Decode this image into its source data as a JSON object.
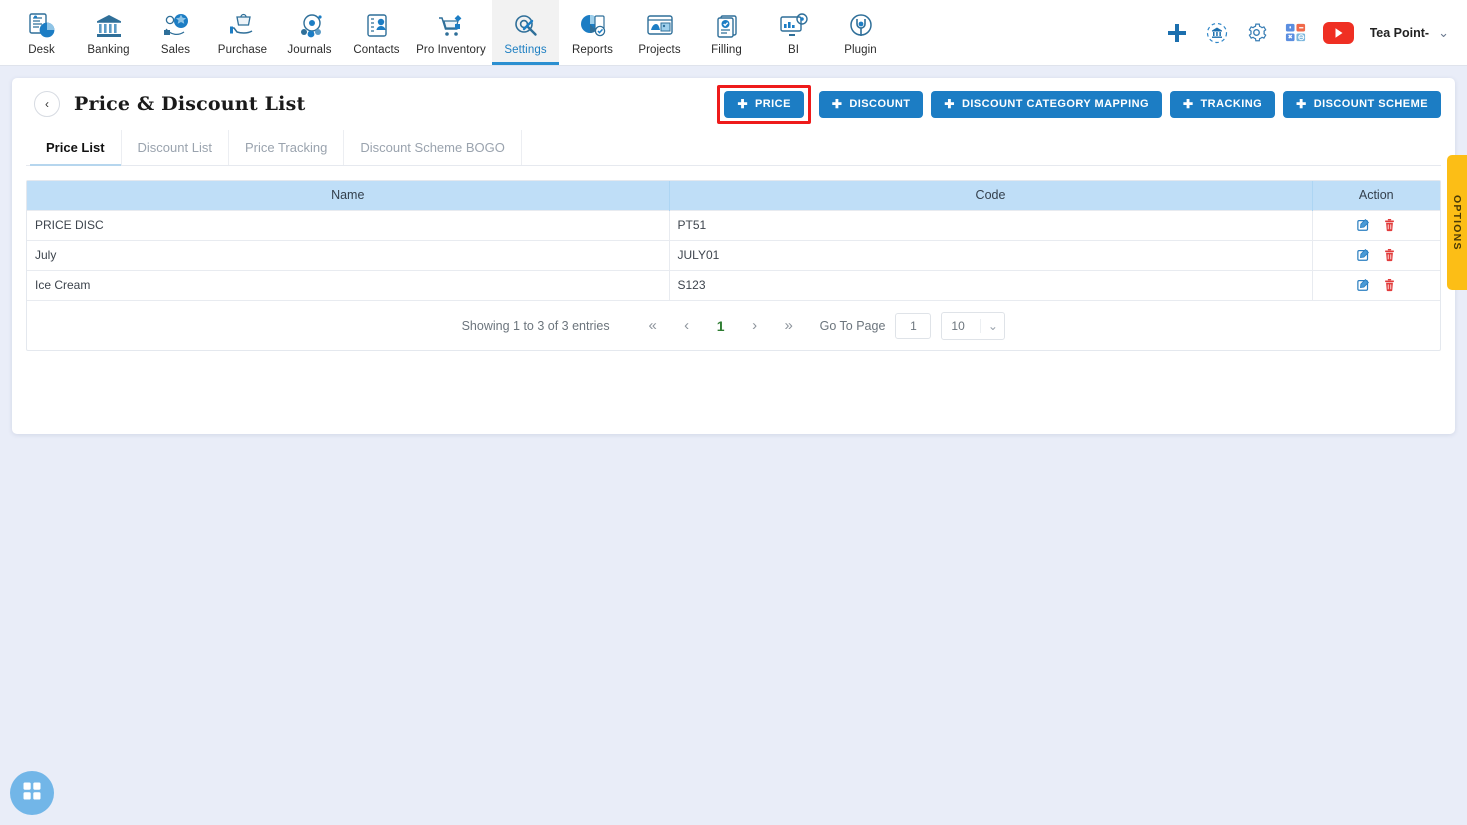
{
  "nav": {
    "items": [
      {
        "label": "Desk",
        "icon": "dashboard-icon",
        "active": false
      },
      {
        "label": "Banking",
        "icon": "bank-icon",
        "active": false
      },
      {
        "label": "Sales",
        "icon": "sales-icon",
        "active": false
      },
      {
        "label": "Purchase",
        "icon": "purchase-icon",
        "active": false
      },
      {
        "label": "Journals",
        "icon": "journals-icon",
        "active": false
      },
      {
        "label": "Contacts",
        "icon": "contacts-icon",
        "active": false
      },
      {
        "label": "Pro Inventory",
        "icon": "inventory-icon",
        "active": false
      },
      {
        "label": "Settings",
        "icon": "settings-icon",
        "active": true
      },
      {
        "label": "Reports",
        "icon": "reports-icon",
        "active": false
      },
      {
        "label": "Projects",
        "icon": "projects-icon",
        "active": false
      },
      {
        "label": "Filling",
        "icon": "filling-icon",
        "active": false
      },
      {
        "label": "BI",
        "icon": "bi-icon",
        "active": false
      },
      {
        "label": "Plugin",
        "icon": "plugin-icon",
        "active": false
      }
    ],
    "right_icons": [
      "add-plus-icon",
      "organization-switch-icon",
      "gear-icon",
      "calculator-icon",
      "youtube-icon"
    ],
    "username": "Tea Point-",
    "caret": "chevron-down-icon"
  },
  "header": {
    "back_label": "‹",
    "title": "Price & Discount List",
    "buttons": [
      {
        "label": "PRICE",
        "icon": "plus-icon",
        "highlighted": true
      },
      {
        "label": "DISCOUNT",
        "icon": "plus-icon",
        "highlighted": false
      },
      {
        "label": "DISCOUNT CATEGORY MAPPING",
        "icon": "plus-icon",
        "highlighted": false
      },
      {
        "label": "TRACKING",
        "icon": "plus-icon",
        "highlighted": false
      },
      {
        "label": "DISCOUNT SCHEME",
        "icon": "plus-icon",
        "highlighted": false
      }
    ]
  },
  "tabs": [
    {
      "label": "Price List",
      "active": true
    },
    {
      "label": "Discount List",
      "active": false
    },
    {
      "label": "Price Tracking",
      "active": false
    },
    {
      "label": "Discount Scheme BOGO",
      "active": false
    }
  ],
  "table": {
    "columns": [
      "Name",
      "Code",
      "Action"
    ],
    "rows": [
      {
        "name": "PRICE DISC",
        "code": "PT51"
      },
      {
        "name": "July",
        "code": "JULY01"
      },
      {
        "name": "Ice Cream",
        "code": "S123"
      }
    ],
    "row_actions": [
      "edit-icon",
      "delete-icon"
    ]
  },
  "pagination": {
    "showing": "Showing 1 to 3 of 3 entries",
    "first": "«",
    "prev": "‹",
    "current_page": "1",
    "next": "›",
    "last": "»",
    "go_to_page_label": "Go To Page",
    "go_to_page_value": "1",
    "page_size": "10",
    "page_size_caret": "chevron-down-icon"
  },
  "options_tab": {
    "label": "OPTIONS"
  },
  "fab": {
    "icon": "apps-grid-icon"
  },
  "colors": {
    "primary": "#1c7dc4",
    "highlight": "#ee1b1b",
    "table_header": "#bfdef7",
    "options": "#fcbe16",
    "page_bg": "#e9edf8",
    "delete": "#e23b3b"
  }
}
